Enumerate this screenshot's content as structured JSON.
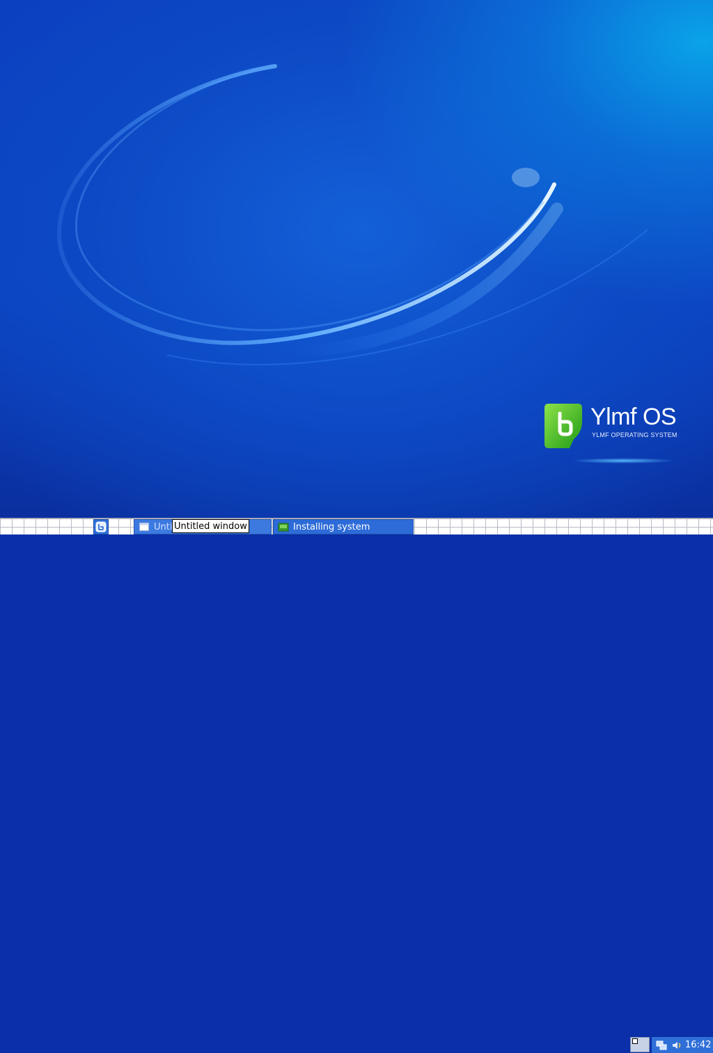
{
  "wallpaper": {
    "brand_name": "Ylmf OS",
    "brand_tagline": "YLMF OPERATING SYSTEM",
    "colors": {
      "background": "#0c43c2",
      "logo_green": "#3fbf1f",
      "swoosh": "#7ec8ff"
    }
  },
  "taskbar": {
    "start_icon": "app-menu-icon",
    "tasks": [
      {
        "label": "Untitled window",
        "icon": "window-icon"
      },
      {
        "label": "Installing system",
        "icon": "installer-icon"
      }
    ],
    "tooltip": "Untitled window",
    "tray_icons": [
      "network-icon",
      "volume-icon"
    ],
    "clock": "16:42",
    "colors": {
      "active": "#2d6bd8"
    }
  }
}
